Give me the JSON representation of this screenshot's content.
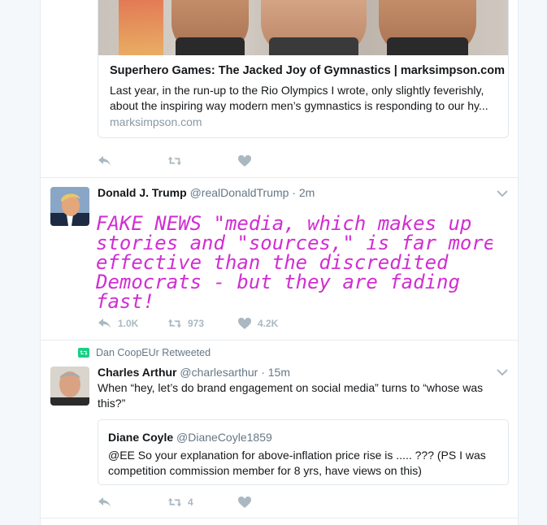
{
  "card": {
    "title": "Superhero Games: The Jacked Joy of Gymnastics | marksimpson.com",
    "description": "Last year, in the run-up to the Rio Olympics I wrote, only slightly feverishly, about the inspiring way modern men’s gymnastics is responding to our hy...",
    "domain": "marksimpson.com"
  },
  "tweet1": {
    "reply_count": "",
    "retweet_count": "",
    "like_count": ""
  },
  "tweet2": {
    "name": "Donald J. Trump",
    "handle": "@realDonaldTrump",
    "time": "· 2m",
    "handwritten_text": "FAKE NEWS \"media, which makes up stories and \"sources,\" is far more effective than the discredited Democrats - but they are fading fast!",
    "reply_count": "1.0K",
    "retweet_count": "973",
    "like_count": "4.2K"
  },
  "tweet3": {
    "retweeted_by": "Dan CoopEUr Retweeted",
    "name": "Charles Arthur",
    "handle": "@charlesarthur",
    "time": "· 15m",
    "text": "When “hey, let’s do brand engagement on social media” turns to “whose was this?”",
    "quote": {
      "name": "Diane Coyle",
      "handle": "@DianeCoyle1859",
      "text": "@EE So your explanation for above-inflation price rise is ..... ??? (PS I was competition commission member for 8 yrs, have views on this)"
    },
    "reply_count": "",
    "retweet_count": "4",
    "like_count": ""
  },
  "colors": {
    "handwriting": "#d12ed1",
    "retweet_green": "#19cf86",
    "icon_gray": "#aab8c2",
    "meta_gray": "#657786"
  }
}
